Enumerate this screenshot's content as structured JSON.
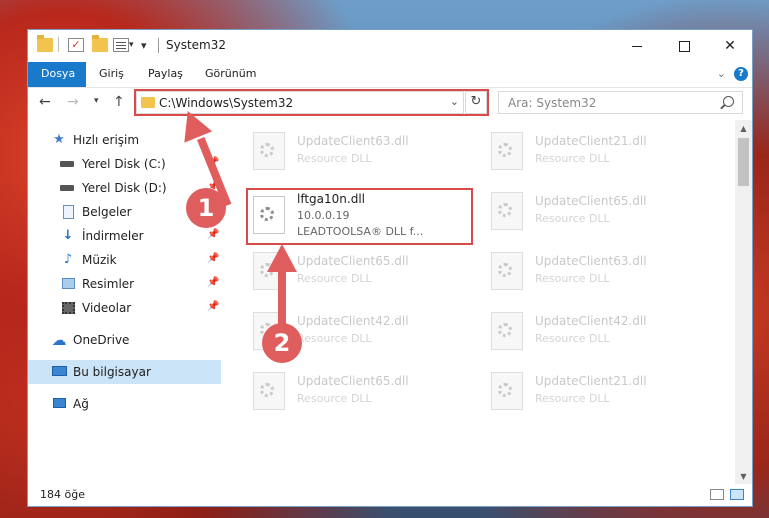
{
  "window": {
    "title": "System32",
    "controls": {
      "minimize": "minimize",
      "maximize": "maximize",
      "close": "✕"
    }
  },
  "ribbon": {
    "tabs": [
      "Dosya",
      "Giriş",
      "Paylaş",
      "Görünüm"
    ],
    "active_tab": "Dosya",
    "help": "?"
  },
  "address_bar": {
    "path": "C:\\Windows\\System32",
    "search_placeholder": "Ara: System32"
  },
  "sidebar": {
    "items": [
      {
        "label": "Hızlı erişim",
        "icon": "star-icon",
        "pinned": false
      },
      {
        "label": "Yerel Disk (C:)",
        "icon": "drive-icon",
        "pinned": true
      },
      {
        "label": "Yerel Disk (D:)",
        "icon": "drive-icon",
        "pinned": true
      },
      {
        "label": "Belgeler",
        "icon": "documents-icon",
        "pinned": true
      },
      {
        "label": "İndirmeler",
        "icon": "download-icon",
        "pinned": true
      },
      {
        "label": "Müzik",
        "icon": "music-icon",
        "pinned": true
      },
      {
        "label": "Resimler",
        "icon": "pictures-icon",
        "pinned": true
      },
      {
        "label": "Videolar",
        "icon": "videos-icon",
        "pinned": true
      },
      {
        "label": "OneDrive",
        "icon": "cloud-icon",
        "pinned": false
      },
      {
        "label": "Bu bilgisayar",
        "icon": "computer-icon",
        "pinned": false,
        "selected": true
      },
      {
        "label": "Ağ",
        "icon": "network-icon",
        "pinned": false
      }
    ]
  },
  "files": {
    "highlighted": {
      "name": "lftga10n.dll",
      "version": "10.0.0.19",
      "description": "LEADTOOLSA® DLL f..."
    },
    "tiles": [
      {
        "name": "UpdateClient63.dll",
        "type": "Resource DLL"
      },
      {
        "name": "UpdateClient21.dll",
        "type": "Resource DLL"
      },
      {
        "name": "UpdateClient65.dll",
        "type": "Resource DLL"
      },
      {
        "name": "UpdateClient65.dll",
        "type": "Resource DLL"
      },
      {
        "name": "UpdateClient63.dll",
        "type": "Resource DLL"
      },
      {
        "name": "UpdateClient42.dll",
        "type": "Resource DLL"
      },
      {
        "name": "UpdateClient42.dll",
        "type": "Resource DLL"
      },
      {
        "name": "UpdateClient65.dll",
        "type": "Resource DLL"
      },
      {
        "name": "UpdateClient21.dll",
        "type": "Resource DLL"
      }
    ]
  },
  "status": {
    "item_count": "184 öğe"
  },
  "annotations": {
    "badge_1": "1",
    "badge_2": "2",
    "color": "#e05d5d"
  }
}
